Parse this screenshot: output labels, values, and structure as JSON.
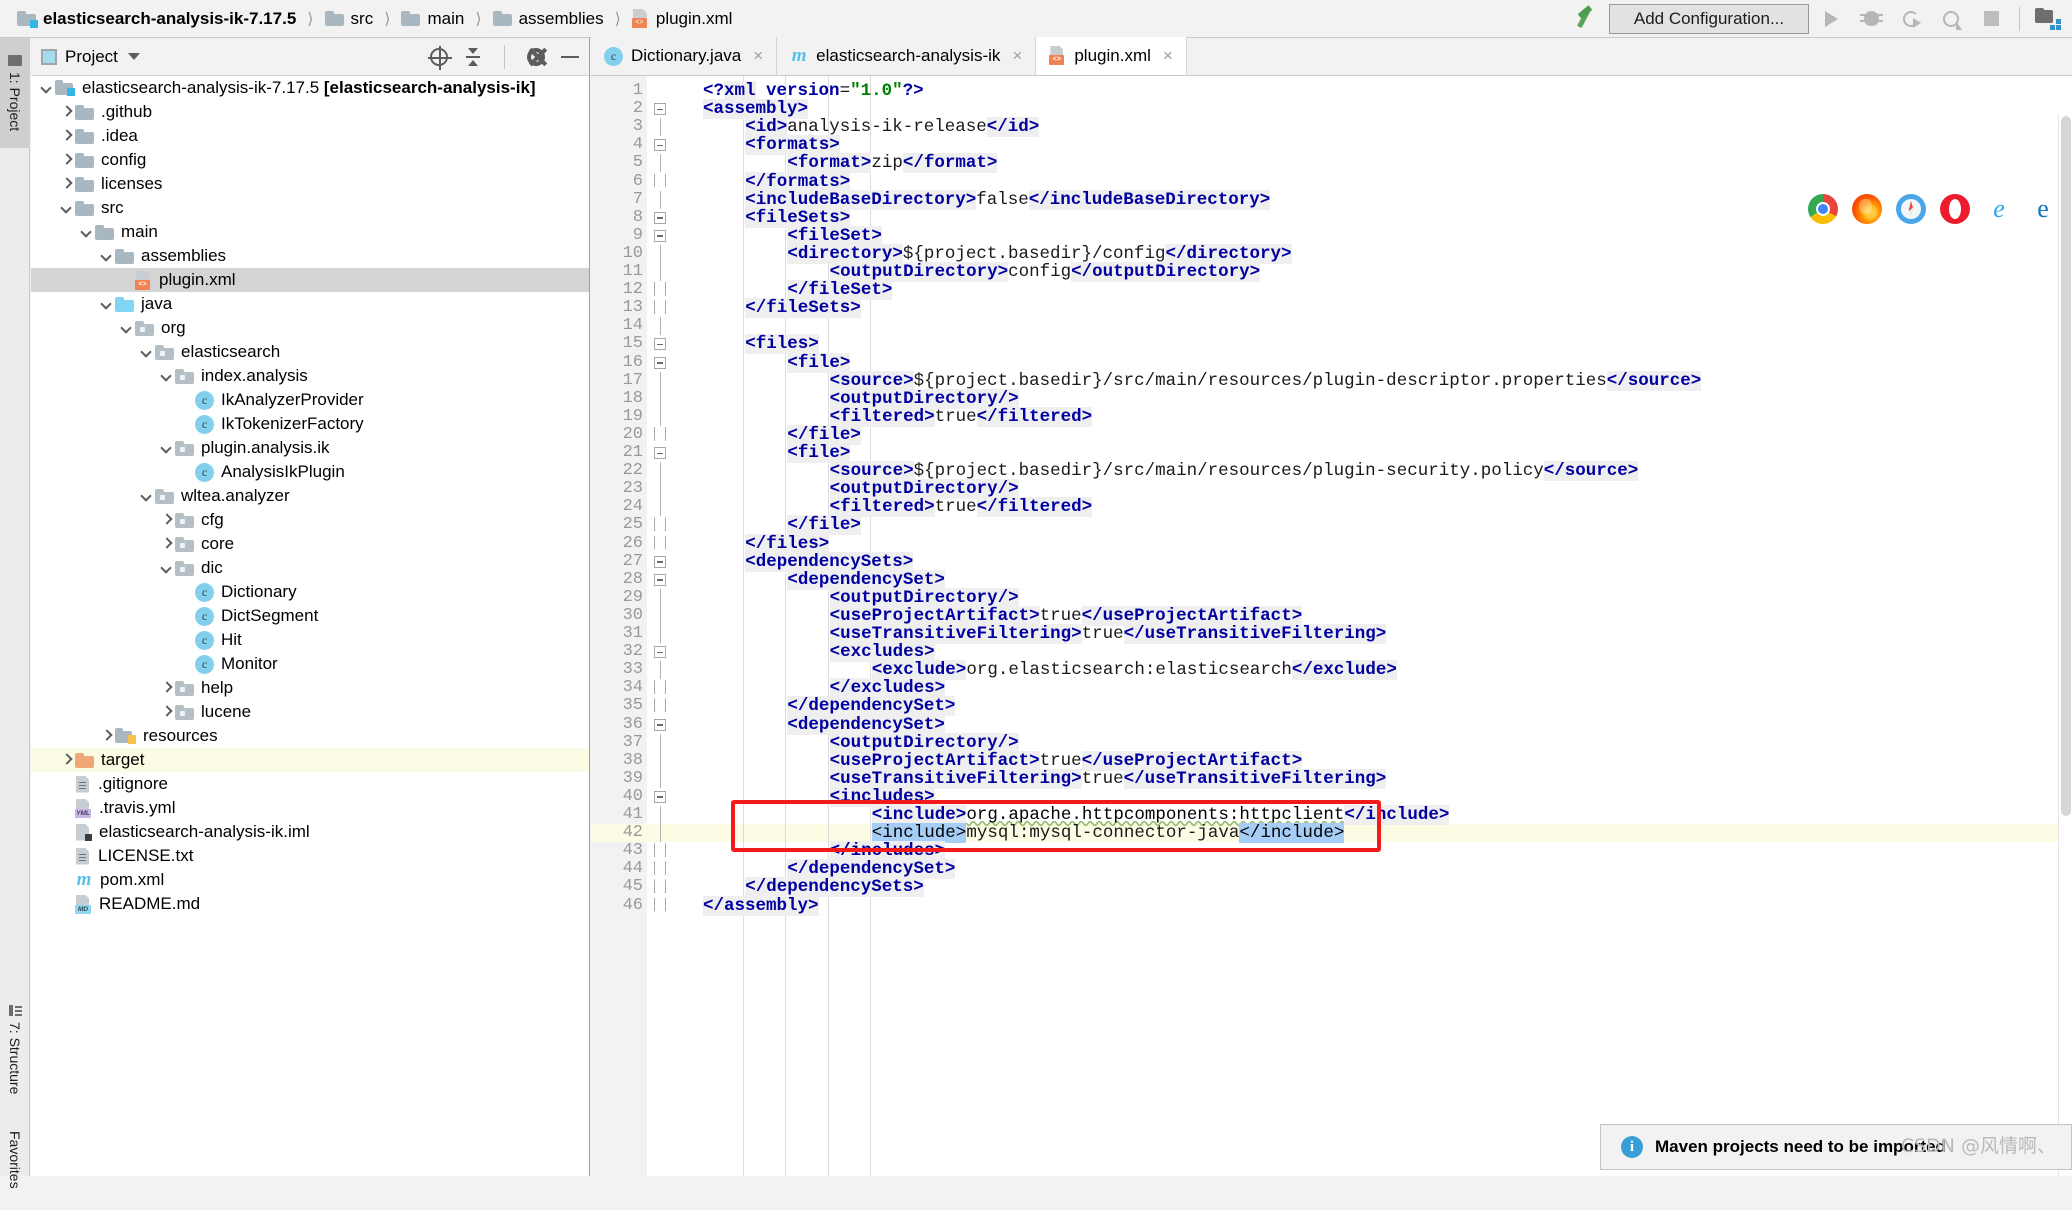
{
  "titlebar": {
    "breadcrumb": [
      {
        "label": "elasticsearch-analysis-ik-7.17.5",
        "icon": "module-icon",
        "bold": true
      },
      {
        "label": "src",
        "icon": "folder-icon"
      },
      {
        "label": "main",
        "icon": "folder-icon"
      },
      {
        "label": "assemblies",
        "icon": "folder-icon"
      },
      {
        "label": "plugin.xml",
        "icon": "xml-file-icon"
      }
    ],
    "separator": "⟩",
    "build_icon": "hammer-icon",
    "add_configuration": "Add Configuration...",
    "run_icon": "run-icon",
    "debug_icon": "debug-icon",
    "run_with_coverage_icon": "run-with-coverage-icon",
    "profile_icon": "profiler-icon",
    "stop_icon": "stop-icon",
    "search_everywhere_icon": "search-everywhere-icon"
  },
  "tool_tabs": [
    {
      "label": "1: Project",
      "icon": "project-icon",
      "active": true
    },
    {
      "label": "7: Structure",
      "icon": "structure-icon",
      "active": false
    },
    {
      "label": "Favorites",
      "icon": "",
      "active": false
    }
  ],
  "project_panel": {
    "title": "Project",
    "title_icon": "project-view-icon",
    "dropdown_icon": "chevron-down-icon",
    "actions": [
      {
        "name": "scroll-from-source-icon"
      },
      {
        "name": "collapse-all-icon"
      },
      {
        "name": "settings-gear-icon"
      },
      {
        "name": "hide-icon"
      }
    ],
    "tree": [
      {
        "depth": 0,
        "arrow": "down",
        "icon": "module-icon",
        "label": "elasticsearch-analysis-ik-7.17.5 ",
        "bold": "[elasticsearch-analysis-ik]",
        "state": "normal"
      },
      {
        "depth": 1,
        "arrow": "right",
        "icon": "folder-gray",
        "label": ".github",
        "state": "normal"
      },
      {
        "depth": 1,
        "arrow": "right",
        "icon": "folder-gray",
        "label": ".idea",
        "state": "normal"
      },
      {
        "depth": 1,
        "arrow": "right",
        "icon": "folder-gray",
        "label": "config",
        "state": "normal"
      },
      {
        "depth": 1,
        "arrow": "right",
        "icon": "folder-gray",
        "label": "licenses",
        "state": "normal"
      },
      {
        "depth": 1,
        "arrow": "down",
        "icon": "folder-gray",
        "label": "src",
        "state": "normal"
      },
      {
        "depth": 2,
        "arrow": "down",
        "icon": "folder-gray",
        "label": "main",
        "state": "normal"
      },
      {
        "depth": 3,
        "arrow": "down",
        "icon": "folder-gray",
        "label": "assemblies",
        "state": "normal"
      },
      {
        "depth": 4,
        "arrow": "none",
        "icon": "xml-file-icon",
        "label": "plugin.xml",
        "state": "selected"
      },
      {
        "depth": 3,
        "arrow": "down",
        "icon": "folder-blue",
        "label": "java",
        "state": "normal"
      },
      {
        "depth": 4,
        "arrow": "down",
        "icon": "package-icon",
        "label": "org",
        "state": "normal"
      },
      {
        "depth": 5,
        "arrow": "down",
        "icon": "package-icon",
        "label": "elasticsearch",
        "state": "normal"
      },
      {
        "depth": 6,
        "arrow": "down",
        "icon": "package-icon",
        "label": "index.analysis",
        "state": "normal"
      },
      {
        "depth": 7,
        "arrow": "none",
        "icon": "class-icon",
        "label": "IkAnalyzerProvider",
        "state": "normal"
      },
      {
        "depth": 7,
        "arrow": "none",
        "icon": "class-icon",
        "label": "IkTokenizerFactory",
        "state": "normal"
      },
      {
        "depth": 6,
        "arrow": "down",
        "icon": "package-icon",
        "label": "plugin.analysis.ik",
        "state": "normal"
      },
      {
        "depth": 7,
        "arrow": "none",
        "icon": "class-icon",
        "label": "AnalysisIkPlugin",
        "state": "normal"
      },
      {
        "depth": 5,
        "arrow": "down",
        "icon": "package-icon",
        "label": "wltea.analyzer",
        "state": "normal"
      },
      {
        "depth": 6,
        "arrow": "right",
        "icon": "package-icon",
        "label": "cfg",
        "state": "normal"
      },
      {
        "depth": 6,
        "arrow": "right",
        "icon": "package-icon",
        "label": "core",
        "state": "normal"
      },
      {
        "depth": 6,
        "arrow": "down",
        "icon": "package-icon",
        "label": "dic",
        "state": "normal"
      },
      {
        "depth": 7,
        "arrow": "none",
        "icon": "class-icon",
        "label": "Dictionary",
        "state": "normal"
      },
      {
        "depth": 7,
        "arrow": "none",
        "icon": "class-icon",
        "label": "DictSegment",
        "state": "normal"
      },
      {
        "depth": 7,
        "arrow": "none",
        "icon": "class-icon",
        "label": "Hit",
        "state": "normal"
      },
      {
        "depth": 7,
        "arrow": "none",
        "icon": "class-icon",
        "label": "Monitor",
        "state": "normal"
      },
      {
        "depth": 6,
        "arrow": "right",
        "icon": "package-icon",
        "label": "help",
        "state": "normal"
      },
      {
        "depth": 6,
        "arrow": "right",
        "icon": "package-icon",
        "label": "lucene",
        "state": "normal"
      },
      {
        "depth": 3,
        "arrow": "right",
        "icon": "resources-folder-icon",
        "label": "resources",
        "state": "normal"
      },
      {
        "depth": 1,
        "arrow": "right",
        "icon": "folder-orange",
        "label": "target",
        "state": "highlighted"
      },
      {
        "depth": 1,
        "arrow": "none",
        "icon": "text-file-icon",
        "label": ".gitignore",
        "state": "normal"
      },
      {
        "depth": 1,
        "arrow": "none",
        "icon": "yml-file-icon",
        "label": ".travis.yml",
        "state": "normal"
      },
      {
        "depth": 1,
        "arrow": "none",
        "icon": "iml-file-icon",
        "label": "elasticsearch-analysis-ik.iml",
        "state": "normal"
      },
      {
        "depth": 1,
        "arrow": "none",
        "icon": "text-file-icon",
        "label": "LICENSE.txt",
        "state": "normal"
      },
      {
        "depth": 1,
        "arrow": "none",
        "icon": "maven-icon",
        "label": "pom.xml",
        "state": "normal"
      },
      {
        "depth": 1,
        "arrow": "none",
        "icon": "md-file-icon",
        "label": "README.md",
        "state": "normal"
      }
    ]
  },
  "editor": {
    "tabs": [
      {
        "label": "Dictionary.java",
        "icon": "class-icon",
        "active": false,
        "close": "×"
      },
      {
        "label": "elasticsearch-analysis-ik",
        "icon": "maven-icon",
        "active": false,
        "close": "×"
      },
      {
        "label": "plugin.xml",
        "icon": "xml-file-icon",
        "active": true,
        "close": "×"
      }
    ],
    "browser_icons": [
      "chrome-icon",
      "firefox-icon",
      "safari-icon",
      "opera-icon",
      "edge-icon",
      "internet-explorer-icon"
    ],
    "current_line": 42,
    "lines": [
      {
        "n": 1,
        "indent": 0,
        "fold": "",
        "tokens": [
          {
            "t": "pi",
            "v": "<?"
          },
          {
            "t": "tg",
            "v": "xml"
          },
          {
            "t": "txt",
            "v": " "
          },
          {
            "t": "attrn",
            "v": "version"
          },
          {
            "t": "txt",
            "v": "="
          },
          {
            "t": "attrv",
            "v": "\"1.0\""
          },
          {
            "t": "pi",
            "v": "?>"
          }
        ]
      },
      {
        "n": 2,
        "indent": 0,
        "fold": "start",
        "tokens": [
          {
            "t": "tg",
            "v": "<assembly>"
          }
        ]
      },
      {
        "n": 3,
        "indent": 1,
        "fold": "line",
        "tokens": [
          {
            "t": "tg",
            "v": "<id>"
          },
          {
            "t": "txt",
            "v": "analysis-ik-release"
          },
          {
            "t": "tg",
            "v": "</id>"
          }
        ]
      },
      {
        "n": 4,
        "indent": 1,
        "fold": "start",
        "tokens": [
          {
            "t": "tg",
            "v": "<formats>"
          }
        ]
      },
      {
        "n": 5,
        "indent": 2,
        "fold": "line",
        "tokens": [
          {
            "t": "tg",
            "v": "<format>"
          },
          {
            "t": "txt",
            "v": "zip"
          },
          {
            "t": "tg",
            "v": "</format>"
          }
        ]
      },
      {
        "n": 6,
        "indent": 1,
        "fold": "end",
        "tokens": [
          {
            "t": "tg",
            "v": "</formats>"
          }
        ]
      },
      {
        "n": 7,
        "indent": 1,
        "fold": "line",
        "tokens": [
          {
            "t": "tg",
            "v": "<includeBaseDirectory>"
          },
          {
            "t": "txt",
            "v": "false"
          },
          {
            "t": "tg",
            "v": "</includeBaseDirectory>"
          }
        ]
      },
      {
        "n": 8,
        "indent": 1,
        "fold": "start",
        "tokens": [
          {
            "t": "tg",
            "v": "<fileSets>"
          }
        ]
      },
      {
        "n": 9,
        "indent": 2,
        "fold": "start",
        "tokens": [
          {
            "t": "tg",
            "v": "<fileSet>"
          }
        ]
      },
      {
        "n": 10,
        "indent": 2,
        "fold": "line",
        "tokens": [
          {
            "t": "tg",
            "v": "<directory>"
          },
          {
            "t": "txt",
            "v": "${project.basedir}/config"
          },
          {
            "t": "tg",
            "v": "</directory>"
          }
        ]
      },
      {
        "n": 11,
        "indent": 3,
        "fold": "line",
        "tokens": [
          {
            "t": "tg",
            "v": "<outputDirectory>"
          },
          {
            "t": "txt",
            "v": "config"
          },
          {
            "t": "tg",
            "v": "</outputDirectory>"
          }
        ]
      },
      {
        "n": 12,
        "indent": 2,
        "fold": "end",
        "tokens": [
          {
            "t": "tg",
            "v": "</fileSet>"
          }
        ]
      },
      {
        "n": 13,
        "indent": 1,
        "fold": "end",
        "tokens": [
          {
            "t": "tg",
            "v": "</fileSets>"
          }
        ]
      },
      {
        "n": 14,
        "indent": 0,
        "fold": "line",
        "tokens": []
      },
      {
        "n": 15,
        "indent": 1,
        "fold": "start",
        "tokens": [
          {
            "t": "tg",
            "v": "<files>"
          }
        ]
      },
      {
        "n": 16,
        "indent": 2,
        "fold": "start",
        "tokens": [
          {
            "t": "tg",
            "v": "<file>"
          }
        ]
      },
      {
        "n": 17,
        "indent": 3,
        "fold": "line",
        "tokens": [
          {
            "t": "tg",
            "v": "<source>"
          },
          {
            "t": "txt",
            "v": "${project.basedir}/src/main/resources/plugin-descriptor.properties"
          },
          {
            "t": "tg",
            "v": "</source>"
          }
        ]
      },
      {
        "n": 18,
        "indent": 3,
        "fold": "line",
        "tokens": [
          {
            "t": "tg",
            "v": "<outputDirectory/>"
          }
        ]
      },
      {
        "n": 19,
        "indent": 3,
        "fold": "line",
        "tokens": [
          {
            "t": "tg",
            "v": "<filtered>"
          },
          {
            "t": "txt",
            "v": "true"
          },
          {
            "t": "tg",
            "v": "</filtered>"
          }
        ]
      },
      {
        "n": 20,
        "indent": 2,
        "fold": "end",
        "tokens": [
          {
            "t": "tg",
            "v": "</file>"
          }
        ]
      },
      {
        "n": 21,
        "indent": 2,
        "fold": "start",
        "tokens": [
          {
            "t": "tg",
            "v": "<file>"
          }
        ]
      },
      {
        "n": 22,
        "indent": 3,
        "fold": "line",
        "tokens": [
          {
            "t": "tg",
            "v": "<source>"
          },
          {
            "t": "txt",
            "v": "${project.basedir}/src/main/resources/plugin-security.policy"
          },
          {
            "t": "tg",
            "v": "</source>"
          }
        ]
      },
      {
        "n": 23,
        "indent": 3,
        "fold": "line",
        "tokens": [
          {
            "t": "tg",
            "v": "<outputDirectory/>"
          }
        ]
      },
      {
        "n": 24,
        "indent": 3,
        "fold": "line",
        "tokens": [
          {
            "t": "tg",
            "v": "<filtered>"
          },
          {
            "t": "txt",
            "v": "true"
          },
          {
            "t": "tg",
            "v": "</filtered>"
          }
        ]
      },
      {
        "n": 25,
        "indent": 2,
        "fold": "end",
        "tokens": [
          {
            "t": "tg",
            "v": "</file>"
          }
        ]
      },
      {
        "n": 26,
        "indent": 1,
        "fold": "end",
        "tokens": [
          {
            "t": "tg",
            "v": "</files>"
          }
        ]
      },
      {
        "n": 27,
        "indent": 1,
        "fold": "start",
        "tokens": [
          {
            "t": "tg",
            "v": "<dependencySets>"
          }
        ]
      },
      {
        "n": 28,
        "indent": 2,
        "fold": "start",
        "tokens": [
          {
            "t": "tg",
            "v": "<dependencySet>"
          }
        ]
      },
      {
        "n": 29,
        "indent": 3,
        "fold": "line",
        "tokens": [
          {
            "t": "tg",
            "v": "<outputDirectory/>"
          }
        ]
      },
      {
        "n": 30,
        "indent": 3,
        "fold": "line",
        "tokens": [
          {
            "t": "tg",
            "v": "<useProjectArtifact>"
          },
          {
            "t": "txt",
            "v": "true"
          },
          {
            "t": "tg",
            "v": "</useProjectArtifact>"
          }
        ]
      },
      {
        "n": 31,
        "indent": 3,
        "fold": "line",
        "tokens": [
          {
            "t": "tg",
            "v": "<useTransitiveFiltering>"
          },
          {
            "t": "txt",
            "v": "true"
          },
          {
            "t": "tg",
            "v": "</useTransitiveFiltering>"
          }
        ]
      },
      {
        "n": 32,
        "indent": 3,
        "fold": "start",
        "tokens": [
          {
            "t": "tg",
            "v": "<excludes>"
          }
        ]
      },
      {
        "n": 33,
        "indent": 4,
        "fold": "line",
        "tokens": [
          {
            "t": "tg",
            "v": "<exclude>"
          },
          {
            "t": "txt",
            "v": "org.elasticsearch:elasticsearch"
          },
          {
            "t": "tg",
            "v": "</exclude>"
          }
        ]
      },
      {
        "n": 34,
        "indent": 3,
        "fold": "end",
        "tokens": [
          {
            "t": "tg",
            "v": "</excludes>"
          }
        ]
      },
      {
        "n": 35,
        "indent": 2,
        "fold": "end",
        "tokens": [
          {
            "t": "tg",
            "v": "</dependencySet>"
          }
        ]
      },
      {
        "n": 36,
        "indent": 2,
        "fold": "start",
        "tokens": [
          {
            "t": "tg",
            "v": "<dependencySet>"
          }
        ]
      },
      {
        "n": 37,
        "indent": 3,
        "fold": "line",
        "tokens": [
          {
            "t": "tg",
            "v": "<outputDirectory/>"
          }
        ]
      },
      {
        "n": 38,
        "indent": 3,
        "fold": "line",
        "tokens": [
          {
            "t": "tg",
            "v": "<useProjectArtifact>"
          },
          {
            "t": "txt",
            "v": "true"
          },
          {
            "t": "tg",
            "v": "</useProjectArtifact>"
          }
        ]
      },
      {
        "n": 39,
        "indent": 3,
        "fold": "line",
        "tokens": [
          {
            "t": "tg",
            "v": "<useTransitiveFiltering>"
          },
          {
            "t": "txt",
            "v": "true"
          },
          {
            "t": "tg",
            "v": "</useTransitiveFiltering>"
          }
        ]
      },
      {
        "n": 40,
        "indent": 3,
        "fold": "start",
        "tokens": [
          {
            "t": "tg",
            "v": "<includes>"
          }
        ]
      },
      {
        "n": 41,
        "indent": 4,
        "fold": "line",
        "tokens": [
          {
            "t": "tg",
            "v": "<include>"
          },
          {
            "t": "squig",
            "v": "org.apache.httpcomponents:httpclient"
          },
          {
            "t": "tg",
            "v": "</include>"
          }
        ]
      },
      {
        "n": 42,
        "indent": 4,
        "fold": "line",
        "tokens": [
          {
            "t": "sel",
            "v": "<include>"
          },
          {
            "t": "txt",
            "v": "mysql:mysql-connector-java"
          },
          {
            "t": "sel",
            "v": "</include>"
          }
        ]
      },
      {
        "n": 43,
        "indent": 3,
        "fold": "end",
        "tokens": [
          {
            "t": "tg",
            "v": "</includes>"
          }
        ]
      },
      {
        "n": 44,
        "indent": 2,
        "fold": "end",
        "tokens": [
          {
            "t": "tg",
            "v": "</dependencySet>"
          }
        ]
      },
      {
        "n": 45,
        "indent": 1,
        "fold": "end",
        "tokens": [
          {
            "t": "tg",
            "v": "</dependencySets>"
          }
        ]
      },
      {
        "n": 46,
        "indent": 0,
        "fold": "end",
        "tokens": [
          {
            "t": "tg",
            "v": "</assembly>"
          }
        ]
      }
    ],
    "annotation": {
      "type": "red-rectangle",
      "covers_lines": "41-43"
    }
  },
  "notification": {
    "icon": "info-icon",
    "message": "Maven projects need to be imported"
  },
  "watermark": "CSDN @风情啊、",
  "colors": {
    "xml_tag": "#0000a0",
    "selection": "#a5cdf5",
    "current_line": "#fcfbe3",
    "annotation_red": "#f21b1b",
    "accent_blue": "#34b6e4"
  }
}
